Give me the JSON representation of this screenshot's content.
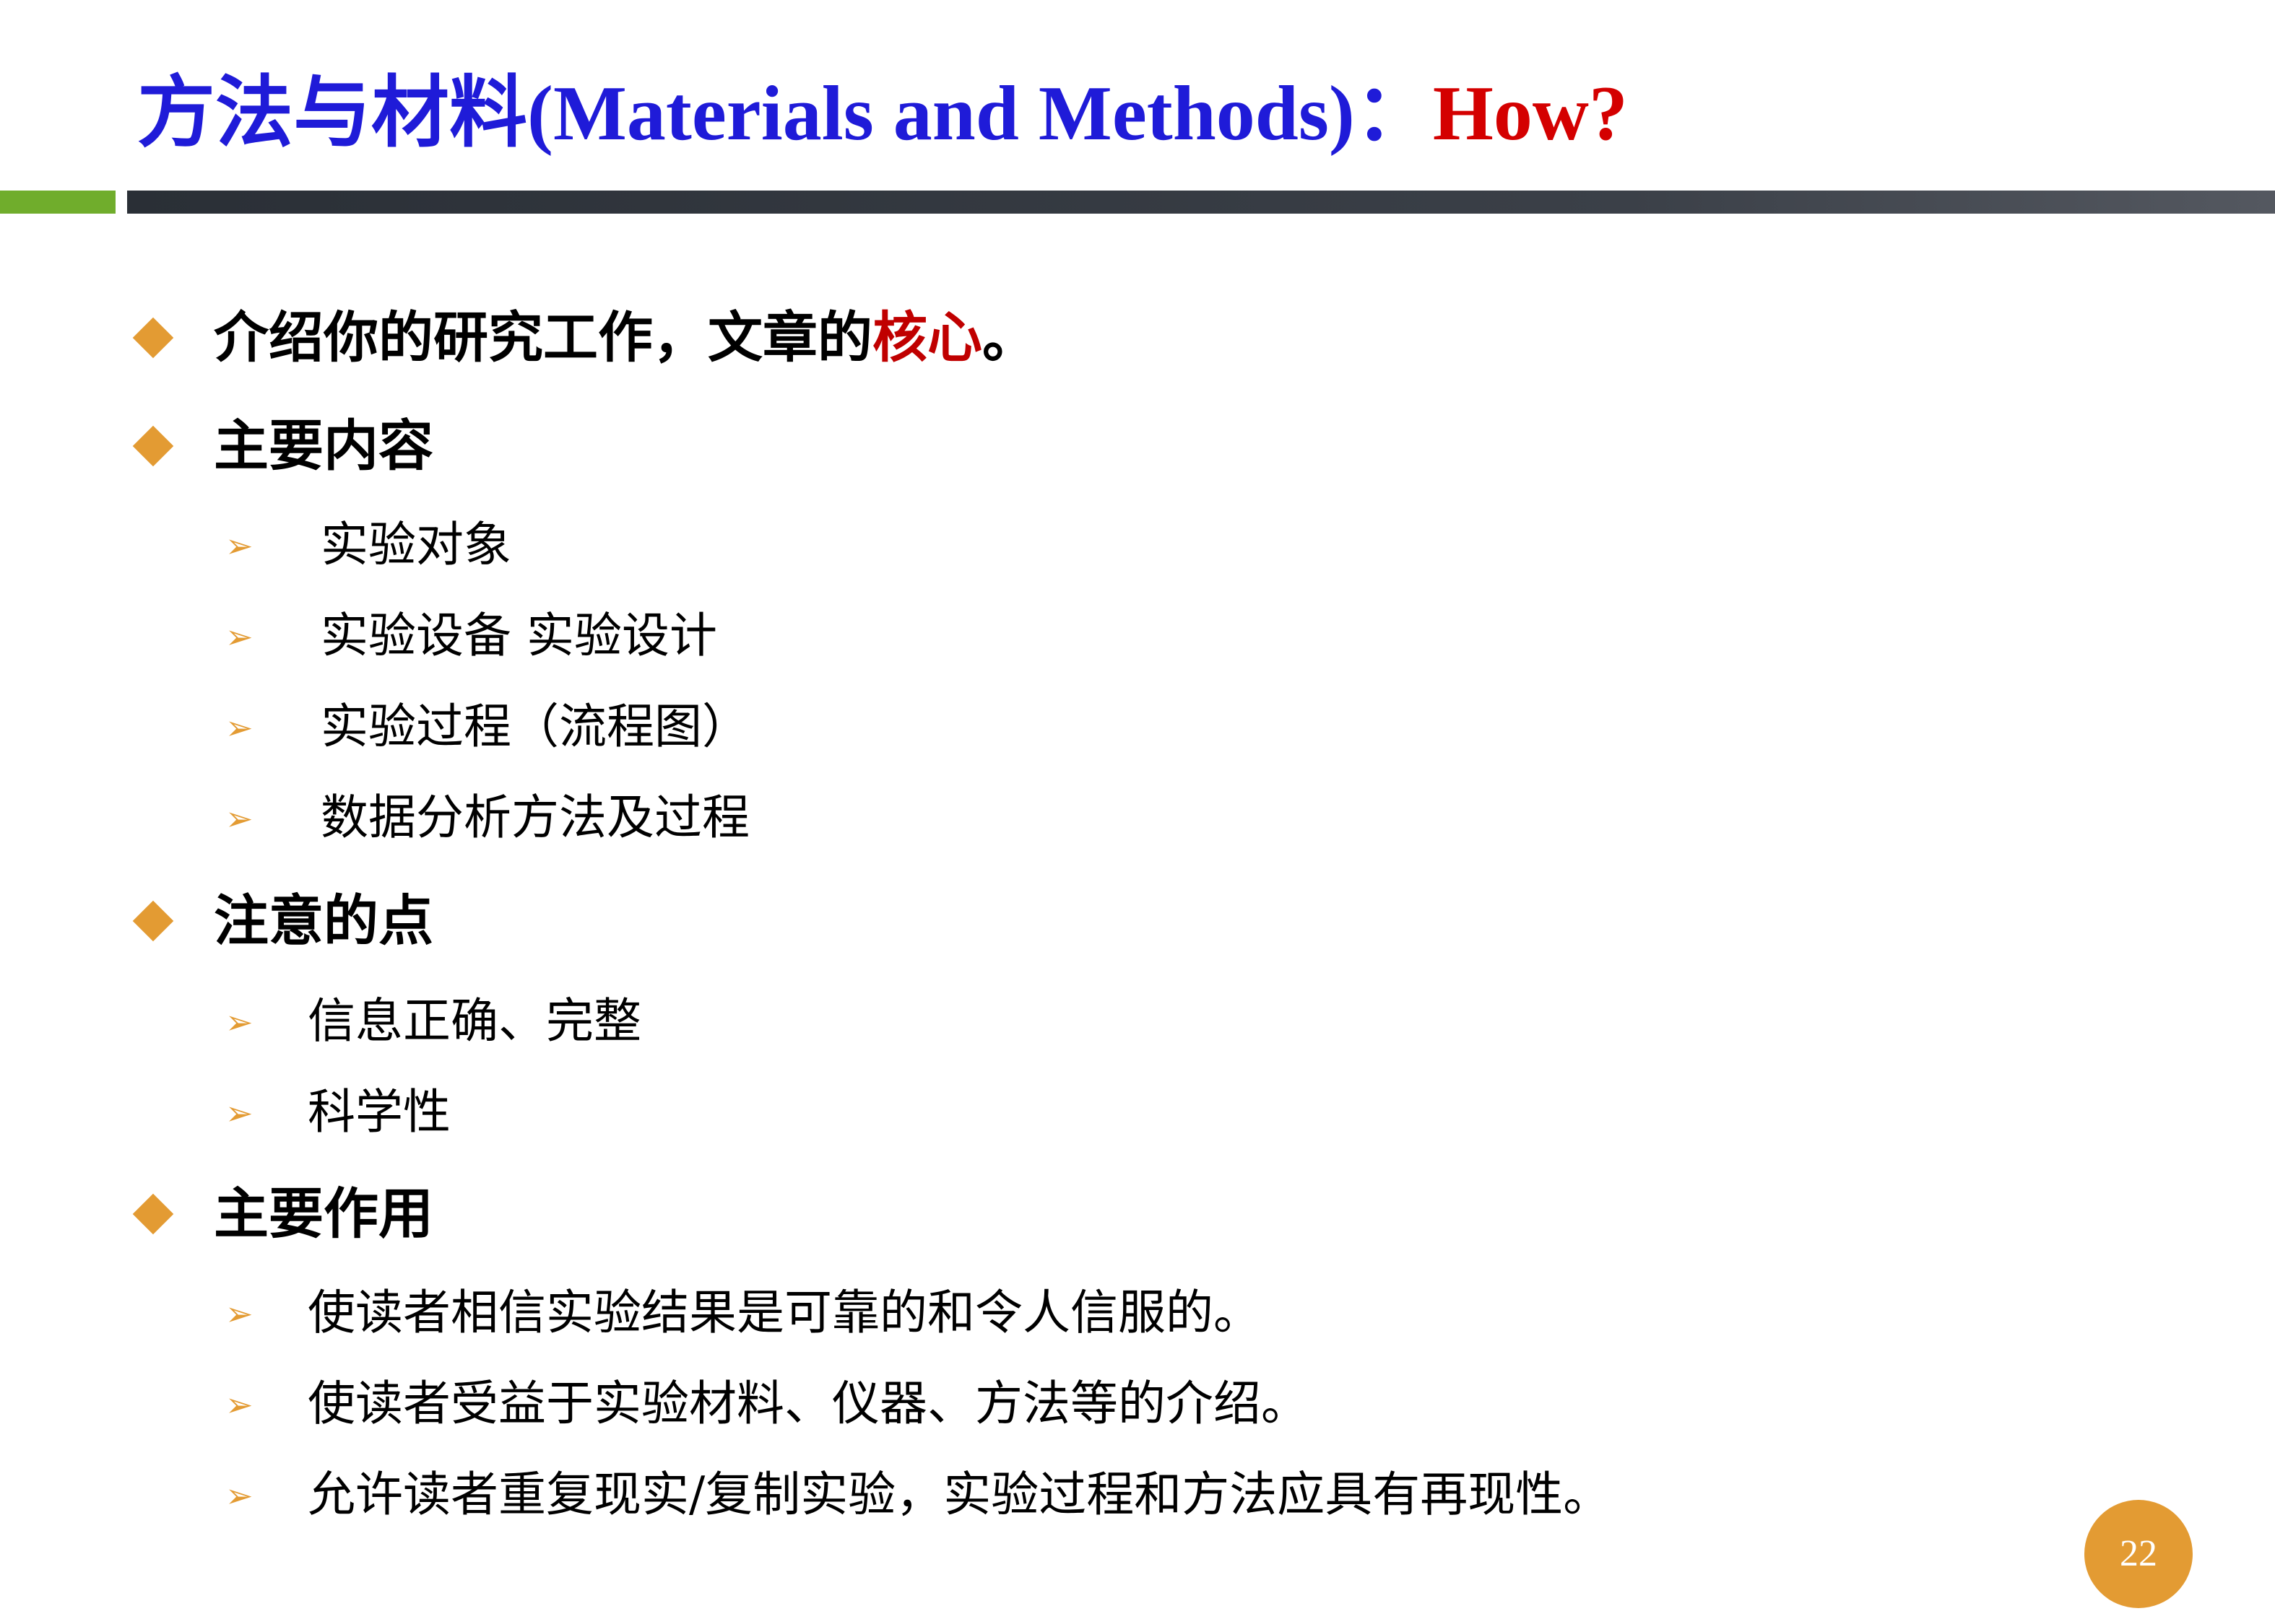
{
  "title": {
    "main": "方法与材料(Materials and Methods)：",
    "accent": "How?"
  },
  "bullets": [
    {
      "text_before": "介绍你的研究工作，文章的",
      "text_highlight": "核心",
      "text_after": "。"
    },
    {
      "text": "主要内容",
      "items": [
        "实验对象",
        "实验设备 实验设计",
        "实验过程（流程图）",
        "数据分析方法及过程"
      ]
    },
    {
      "text": "注意的点",
      "items": [
        "信息正确、完整",
        "科学性"
      ]
    },
    {
      "text": "主要作用",
      "items": [
        "使读者相信实验结果是可靠的和令人信服的。",
        "使读者受益于实验材料、仪器、方法等的介绍。",
        "允许读者重复现实/复制实验，实验过程和方法应具有再现性。"
      ]
    }
  ],
  "page_number": "22",
  "colors": {
    "title_blue": "#1f1bd8",
    "title_red": "#d40000",
    "bullet_orange": "#e39b33",
    "bar_green": "#70ad2c",
    "bar_dark": "#2a2f36",
    "highlight_red": "#c00000"
  },
  "icons": {
    "level1": "diamond-bullet",
    "level2": "arrowhead-bullet"
  }
}
